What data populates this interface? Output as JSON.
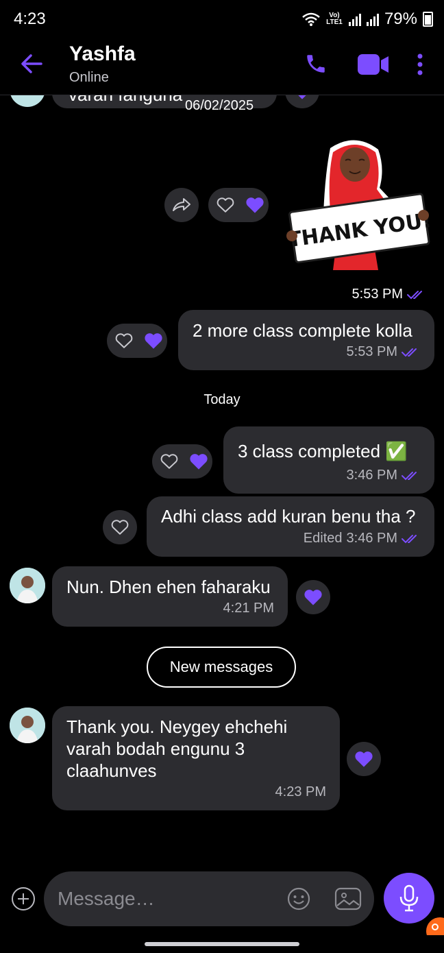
{
  "status_bar": {
    "time": "4:23",
    "volte": "Vo) LTE1",
    "battery": "79%"
  },
  "header": {
    "name": "Yashfa",
    "status": "Online"
  },
  "partial_top": {
    "text": "varah fanguna",
    "date": "06/02/2025"
  },
  "sticker": {
    "caption": "THANK YOU!",
    "time": "5:53 PM"
  },
  "messages": [
    {
      "id": "m1",
      "direction": "out",
      "text": "2 more class complete kolla",
      "time": "5:53 PM"
    },
    {
      "id": "m2",
      "direction": "out",
      "text": "3 class completed ✅",
      "time": "3:46 PM"
    },
    {
      "id": "m3",
      "direction": "out",
      "text": "Adhi class add kuran benu tha ?",
      "edited": "Edited",
      "time": "3:46 PM"
    },
    {
      "id": "m4",
      "direction": "in",
      "text": "Nun. Dhen ehen faharaku",
      "time": "4:21 PM"
    },
    {
      "id": "m5",
      "direction": "in",
      "text": "Thank you. Neygey ehchehi varah bodah engunu 3 claahunves",
      "time": "4:23 PM"
    }
  ],
  "date_separator": "Today",
  "new_messages_label": "New messages",
  "composer": {
    "placeholder": "Message…"
  },
  "colors": {
    "accent": "#7c4dff",
    "bubble": "#2c2c30",
    "background": "#000000"
  }
}
